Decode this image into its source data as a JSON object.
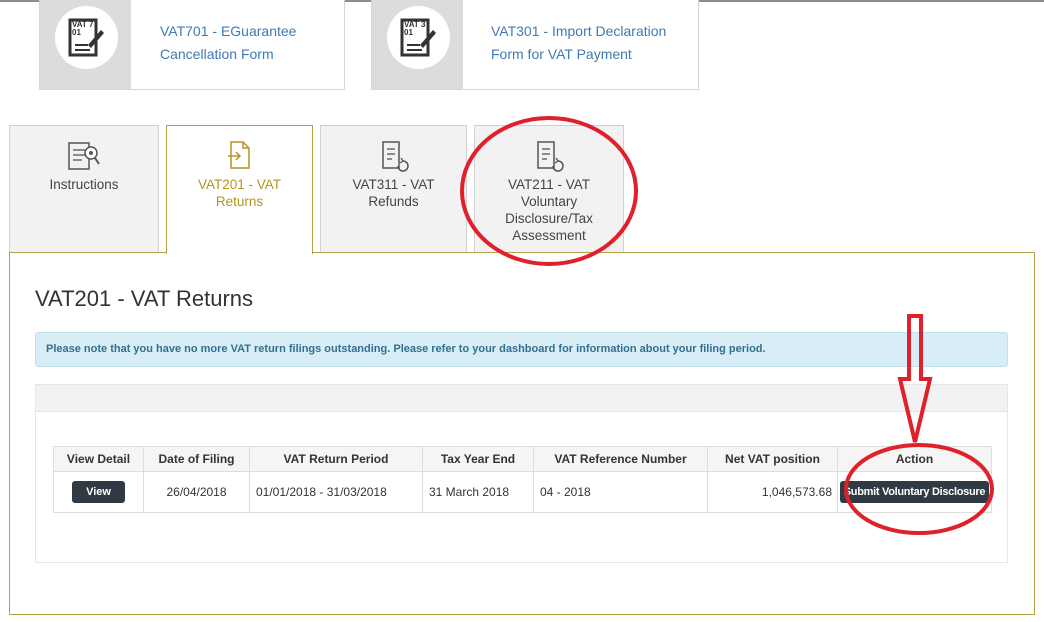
{
  "cards": [
    {
      "code_label": "VAT 701",
      "title": "VAT701 - EGuarantee Cancellation Form"
    },
    {
      "code_label": "VAT 301",
      "title": "VAT301 - Import Declaration Form for VAT Payment"
    }
  ],
  "tabs": [
    {
      "label": "Instructions"
    },
    {
      "label": "VAT201 - VAT Returns"
    },
    {
      "label": "VAT311 - VAT Refunds"
    },
    {
      "label": "VAT211 - VAT Voluntary Disclosure/Tax Assessment"
    }
  ],
  "panel": {
    "title": "VAT201 - VAT Returns",
    "notice": "Please note that you have no more VAT return filings outstanding. Please refer to your dashboard for information about your filing period."
  },
  "table": {
    "headers": [
      "View Detail",
      "Date of Filing",
      "VAT Return Period",
      "Tax Year End",
      "VAT Reference Number",
      "Net VAT position",
      "Action"
    ],
    "row": {
      "view_label": "View",
      "date_of_filing": "26/04/2018",
      "return_period": "01/01/2018 - 31/03/2018",
      "tax_year_end": "31 March 2018",
      "reference": "04 - 2018",
      "net_vat": "1,046,573.68",
      "action_label": "Submit Voluntary Disclosure"
    }
  },
  "colors": {
    "accent_gold": "#b8941f",
    "link_blue": "#3f7ab3",
    "annotation_red": "#e0202a",
    "button_dark": "#2f3a45",
    "notice_bg": "#d9edf7"
  },
  "icons": [
    "document-pen-icon",
    "document-search-icon",
    "document-arrow-icon",
    "document-refresh-icon"
  ]
}
